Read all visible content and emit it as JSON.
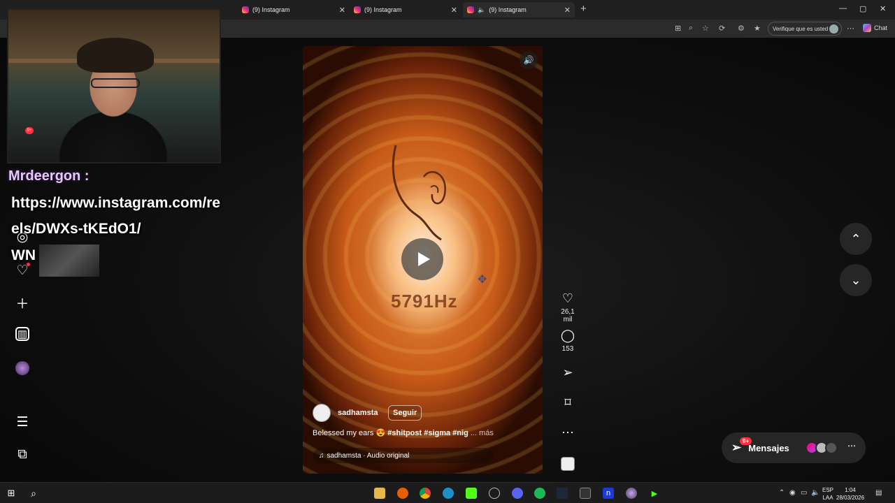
{
  "browser": {
    "tabs": [
      {
        "title": "(9) Instagram"
      },
      {
        "title": "(9) Instagram"
      },
      {
        "title": "(9) Instagram"
      }
    ],
    "verify_label": "Verifique que es usted",
    "chat_label": "Chat"
  },
  "stream_chat": {
    "username": "Mrdeergon :",
    "line1": "https://www.instagram.com/re",
    "line2": "els/DWXs-tKEdO1/",
    "line3": "WN",
    "notif_count": "9+"
  },
  "reel": {
    "overlay_text": "5791Hz",
    "owner": "sadhamsta",
    "follow_label": "Seguir",
    "caption_text": "Belessed my ears",
    "caption_emoji": "😍",
    "caption_tags": "#shitpost #sigma #nig",
    "caption_more": "... más",
    "audio": "sadhamsta · Audio original",
    "likes": "26,1 mil",
    "comments": "153"
  },
  "messages": {
    "label": "Mensajes",
    "badge": "9+"
  },
  "taskbar": {
    "lang_line1": "ESP",
    "lang_line2": "LAA",
    "time": "1:04",
    "date": "28/03/2026"
  },
  "icons": {
    "volume": "volume-icon",
    "play": "play-icon",
    "like": "heart-icon",
    "comment": "comment-icon",
    "share": "share-icon",
    "save": "bookmark-icon",
    "more": "more-icon",
    "up": "chevron-up-icon",
    "down": "chevron-down-icon"
  }
}
